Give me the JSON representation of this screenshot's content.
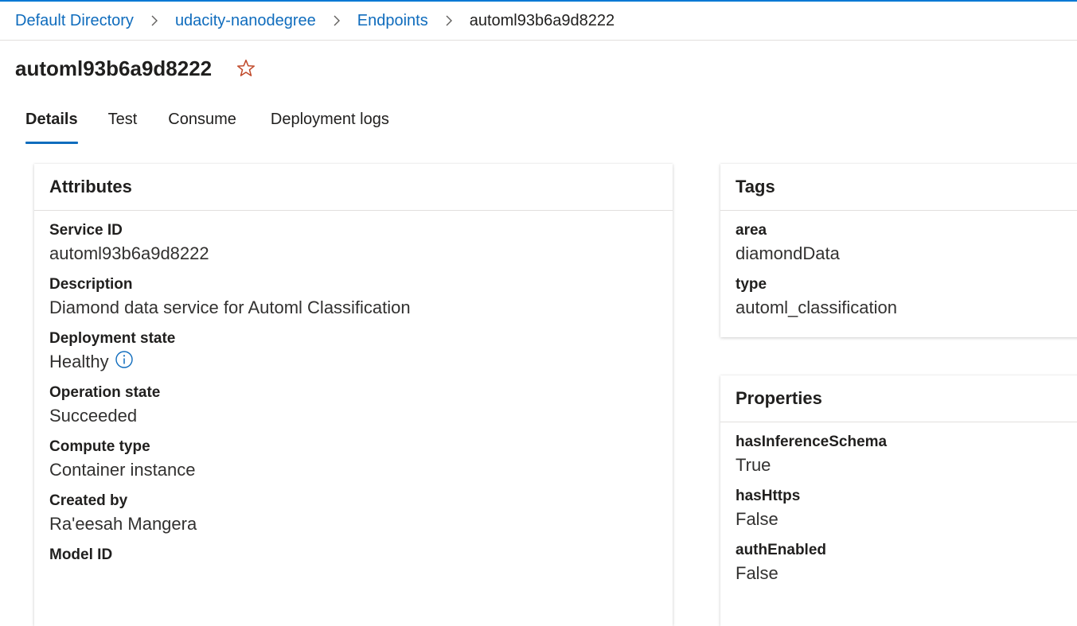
{
  "breadcrumb": {
    "items": [
      "Default Directory",
      "udacity-nanodegree",
      "Endpoints"
    ],
    "current": "automl93b6a9d8222"
  },
  "page": {
    "title": "automl93b6a9d8222"
  },
  "tabs": [
    "Details",
    "Test",
    "Consume",
    "Deployment logs"
  ],
  "attributes": {
    "header": "Attributes",
    "fields": [
      {
        "label": "Service ID",
        "value": "automl93b6a9d8222"
      },
      {
        "label": "Description",
        "value": "Diamond data service for Automl Classification"
      },
      {
        "label": "Deployment state",
        "value": "Healthy"
      },
      {
        "label": "Operation state",
        "value": "Succeeded"
      },
      {
        "label": "Compute type",
        "value": "Container instance"
      },
      {
        "label": "Created by",
        "value": "Ra'eesah Mangera"
      },
      {
        "label": "Model ID",
        "value": ""
      }
    ]
  },
  "tags": {
    "header": "Tags",
    "fields": [
      {
        "label": "area",
        "value": "diamondData"
      },
      {
        "label": "type",
        "value": "automl_classification"
      }
    ]
  },
  "properties": {
    "header": "Properties",
    "fields": [
      {
        "label": "hasInferenceSchema",
        "value": "True"
      },
      {
        "label": "hasHttps",
        "value": "False"
      },
      {
        "label": "authEnabled",
        "value": "False"
      }
    ]
  },
  "icons": {
    "favorite": "star-outline-icon",
    "info": "info-circle-icon",
    "separator": "chevron-right-icon"
  },
  "colors": {
    "accent": "#0f6cbd",
    "star": "#c0492a",
    "top_bar": "#0078d4"
  }
}
